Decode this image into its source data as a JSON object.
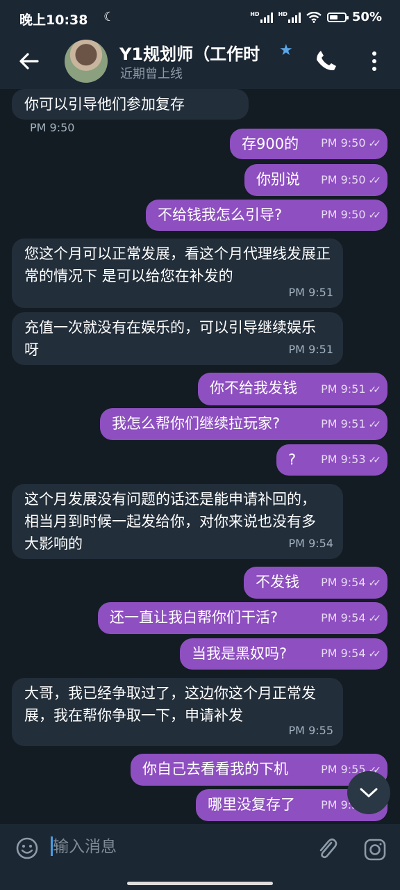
{
  "status_bar": {
    "time": "晚上10:38",
    "moon_icon": "moon-icon",
    "battery_label": "50%"
  },
  "header": {
    "title": "Y1规划师（工作时",
    "subtitle": "近期曾上线",
    "star_icon": "star-icon"
  },
  "messages": [
    {
      "dir": "in",
      "text": "你可以引导他们参加复存",
      "time": "PM 9:50"
    },
    {
      "dir": "out",
      "text": "存900的",
      "time": "PM 9:50"
    },
    {
      "dir": "out",
      "text": "你别说",
      "time": "PM 9:50"
    },
    {
      "dir": "out",
      "text": "不给钱我怎么引导?",
      "time": "PM 9:50"
    },
    {
      "dir": "in",
      "text": "您这个月可以正常发展，看这个月代理线发展正常的情况下 是可以给您在补发的",
      "time": "PM 9:51"
    },
    {
      "dir": "in",
      "text": "充值一次就没有在娱乐的，可以引导继续娱乐呀",
      "time": "PM 9:51"
    },
    {
      "dir": "out",
      "text": "你不给我发钱",
      "time": "PM 9:51"
    },
    {
      "dir": "out",
      "text": "我怎么帮你们继续拉玩家?",
      "time": "PM 9:51"
    },
    {
      "dir": "out",
      "text": "?",
      "time": "PM 9:53"
    },
    {
      "dir": "in",
      "text": "这个月发展没有问题的话还是能申请补回的，相当月到时候一起发给你，对你来说也没有多大影响的",
      "time": "PM 9:54"
    },
    {
      "dir": "out",
      "text": "不发钱",
      "time": "PM 9:54"
    },
    {
      "dir": "out",
      "text": "还一直让我白帮你们干活?",
      "time": "PM 9:54"
    },
    {
      "dir": "out",
      "text": "当我是黑奴吗?",
      "time": "PM 9:54"
    },
    {
      "dir": "in",
      "text": "大哥，我已经争取过了，这边你这个月正常发展，我在帮你争取一下，申请补发",
      "time": "PM 9:55"
    },
    {
      "dir": "out",
      "text": "你自己去看看我的下机",
      "time": "PM 9:55"
    },
    {
      "dir": "out",
      "text": "哪里没复存了",
      "time": "PM 9:55"
    }
  ],
  "input": {
    "placeholder": "输入消息"
  },
  "colors": {
    "background": "#131b23",
    "header": "#1b2733",
    "incoming_bubble": "#222e3a",
    "outgoing_bubble": "#8e4fc0",
    "accent": "#5aa6e8"
  }
}
